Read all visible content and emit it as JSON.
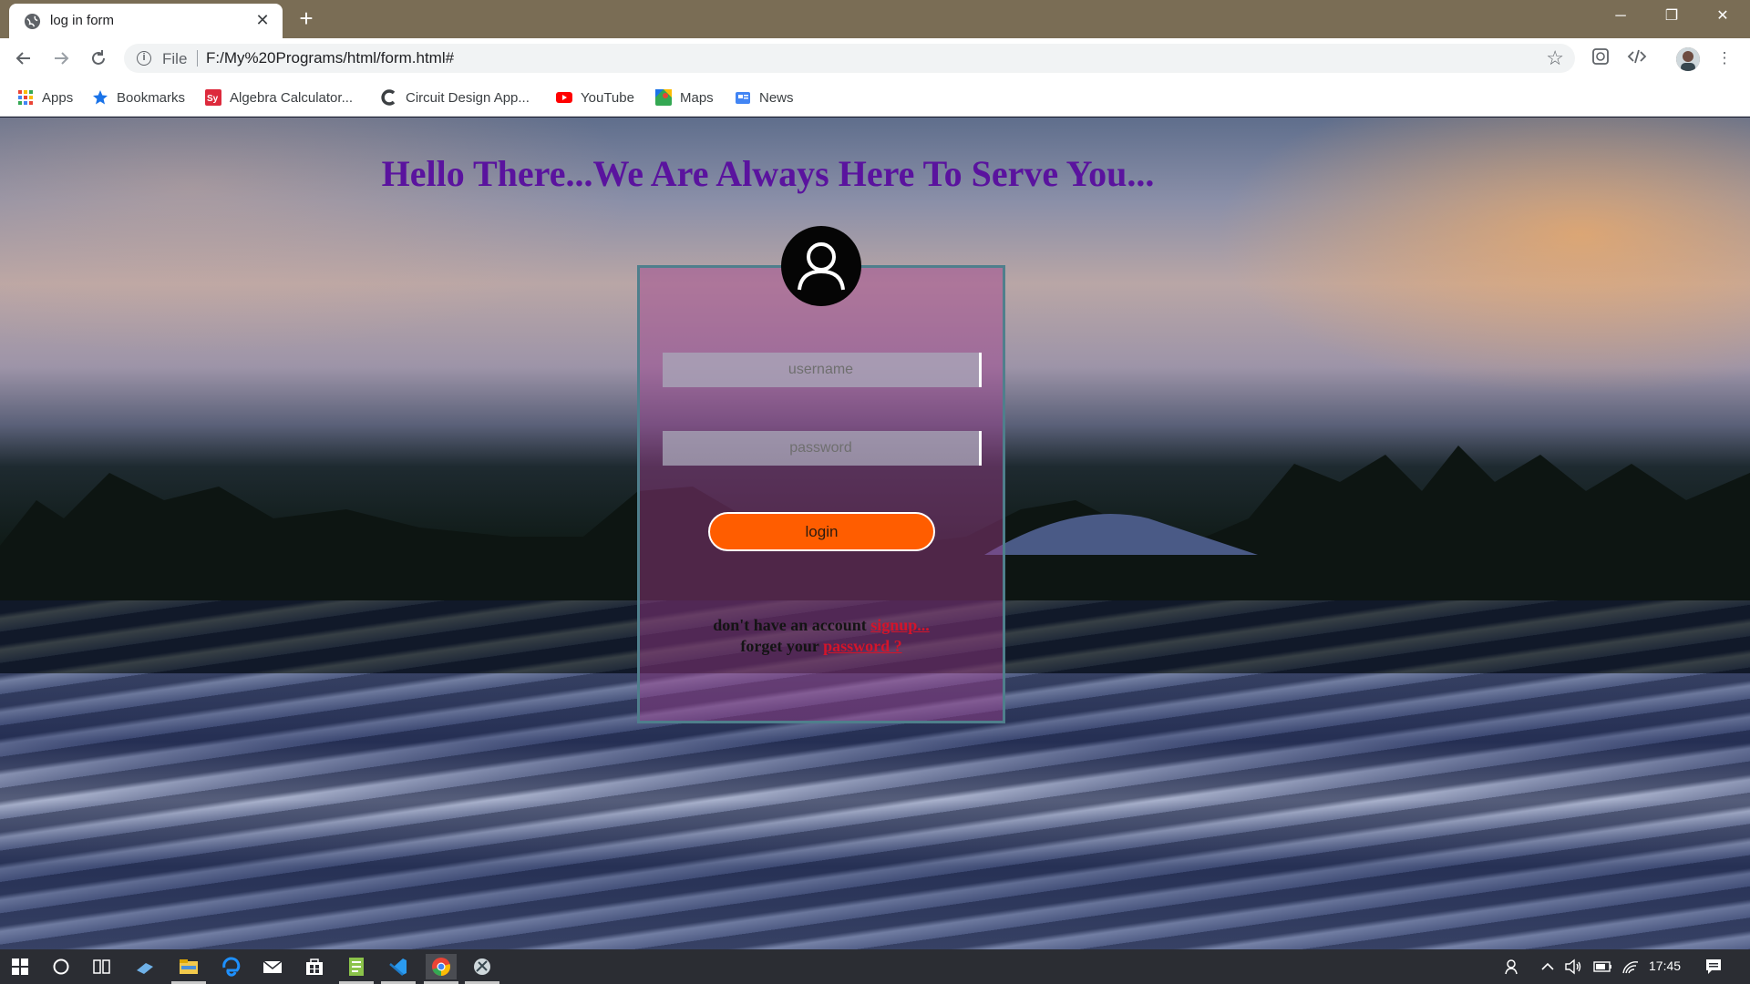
{
  "browser": {
    "tab_title": "log in form",
    "tab_close": "✕",
    "new_tab": "+",
    "scheme_label": "File",
    "url": "F:/My%20Programs/html/form.html#",
    "window_buttons": {
      "minimize": "─",
      "restore": "❐",
      "close": "✕"
    }
  },
  "bookmarks": [
    {
      "label": "Apps",
      "icon": "apps-grid-icon"
    },
    {
      "label": "Bookmarks",
      "icon": "star-icon"
    },
    {
      "label": "Algebra Calculator...",
      "icon": "symbolab-icon"
    },
    {
      "label": "Circuit Design App...",
      "icon": "circuit-icon"
    },
    {
      "label": "YouTube",
      "icon": "youtube-icon"
    },
    {
      "label": "Maps",
      "icon": "maps-icon"
    },
    {
      "label": "News",
      "icon": "news-icon"
    }
  ],
  "page": {
    "heading": "Hello There...We Are Always Here To Serve You...",
    "username_placeholder": "username",
    "password_placeholder": "password",
    "login_label": "login",
    "signup_prefix": "don't have an account ",
    "signup_link": "signup...",
    "forgot_prefix": "forget your ",
    "forgot_link": "password ?"
  },
  "taskbar": {
    "clock": "17:45"
  },
  "colors": {
    "heading": "#5a139e",
    "login_button": "#ff5d00",
    "link": "#d4142a",
    "titlebar": "#7a6d55"
  }
}
